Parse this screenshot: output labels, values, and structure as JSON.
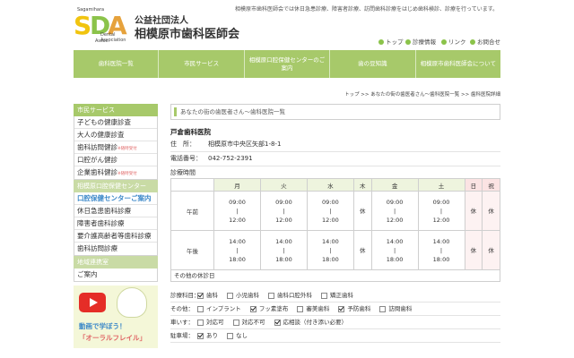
{
  "header": {
    "logo_letters": [
      "S",
      "D",
      "A"
    ],
    "logo_text_top": "Sagamihara",
    "logo_text_mid": "Dental Association",
    "logo_text_bot": "Assoc.",
    "org_small": "公益社団法人",
    "org_big": "相模原市歯科医師会",
    "tagline": "相模原市歯科医師会では休日急患診療、障害者診療、訪問歯科診療をはじめ歯科検診、診療を行っています。",
    "utility_links": [
      "トップ",
      "診療情報",
      "リンク",
      "お問合せ"
    ]
  },
  "nav": {
    "items": [
      "歯科医院一覧",
      "市民サービス",
      "相模原口腔保健センターのご案内",
      "歯の豆知識",
      "相模原市歯科医師会について"
    ]
  },
  "breadcrumb": "トップ >> あなたの街の歯医者さん〜歯科医院一覧 >> 歯科医院詳細",
  "sidebar": {
    "section1_title": "市民サービス",
    "section1_items": [
      {
        "label": "子どもの健康診査",
        "sub": ""
      },
      {
        "label": "大人の健康診査",
        "sub": ""
      },
      {
        "label": "歯科訪問健診",
        "sub": "※随時受付"
      },
      {
        "label": "口腔がん健診",
        "sub": ""
      },
      {
        "label": "企業歯科健診",
        "sub": "※随時受付"
      }
    ],
    "section2_title": "相模原口腔保健センター",
    "section2_items": [
      {
        "label": "口腔保健センターご案内",
        "sub": ""
      },
      {
        "label": "休日急患歯科診療",
        "sub": ""
      },
      {
        "label": "障害者歯科診療",
        "sub": ""
      },
      {
        "label": "要介護高齢者等歯科診療",
        "sub": ""
      },
      {
        "label": "歯科訪問診療",
        "sub": ""
      }
    ],
    "section3_title": "地域連携室",
    "section3_items": [
      {
        "label": "ご案内",
        "sub": ""
      }
    ],
    "banner_line1": "動画で学ぼう！",
    "banner_line2": "「オーラルフレイル」"
  },
  "main": {
    "section_title": "あなたの街の歯医者さん〜歯科医院一覧",
    "clinic_name": "戸倉歯科医院",
    "address_label": "住　所：",
    "address": "相模原市中央区矢部1-8-1",
    "phone_label": "電話番号：",
    "phone": "042-752-2391",
    "hours_label": "診療時間",
    "days": [
      "月",
      "火",
      "水",
      "木",
      "金",
      "土",
      "日",
      "祝"
    ],
    "am_label": "午前",
    "pm_label": "午後",
    "am": [
      "09:00\n|\n12:00",
      "09:00\n|\n12:00",
      "09:00\n|\n12:00",
      "休",
      "09:00\n|\n12:00",
      "09:00\n|\n12:00",
      "休",
      "休"
    ],
    "pm": [
      "14:00\n|\n18:00",
      "14:00\n|\n18:00",
      "14:00\n|\n18:00",
      "休",
      "14:00\n|\n18:00",
      "14:00\n|\n18:00",
      "休",
      "休"
    ],
    "other_holidays_label": "その他の休診日"
  },
  "options": {
    "rows": [
      {
        "label": "診療科目：",
        "items": [
          {
            "text": "歯科",
            "checked": true
          },
          {
            "text": "小児歯科",
            "checked": false
          },
          {
            "text": "歯科口腔外科",
            "checked": false
          },
          {
            "text": "矯正歯科",
            "checked": false
          }
        ]
      },
      {
        "label": "その他：",
        "items": [
          {
            "text": "インプラント",
            "checked": false
          },
          {
            "text": "フッ素塗布",
            "checked": true
          },
          {
            "text": "審美歯科",
            "checked": false
          },
          {
            "text": "予防歯科",
            "checked": true
          },
          {
            "text": "訪問歯科",
            "checked": false
          }
        ]
      },
      {
        "label": "車いす：",
        "items": [
          {
            "text": "対応可",
            "checked": false
          },
          {
            "text": "対応不可",
            "checked": false
          },
          {
            "text": "応相談（付き添い必要）",
            "checked": true
          }
        ]
      },
      {
        "label": "駐車場：",
        "items": [
          {
            "text": "あり",
            "checked": true
          },
          {
            "text": "なし",
            "checked": false
          }
        ]
      }
    ]
  },
  "colors": {
    "nav_green": "#a7c96a",
    "active_blue": "#3a87c8",
    "holiday_pink": "#fbe3e3"
  }
}
